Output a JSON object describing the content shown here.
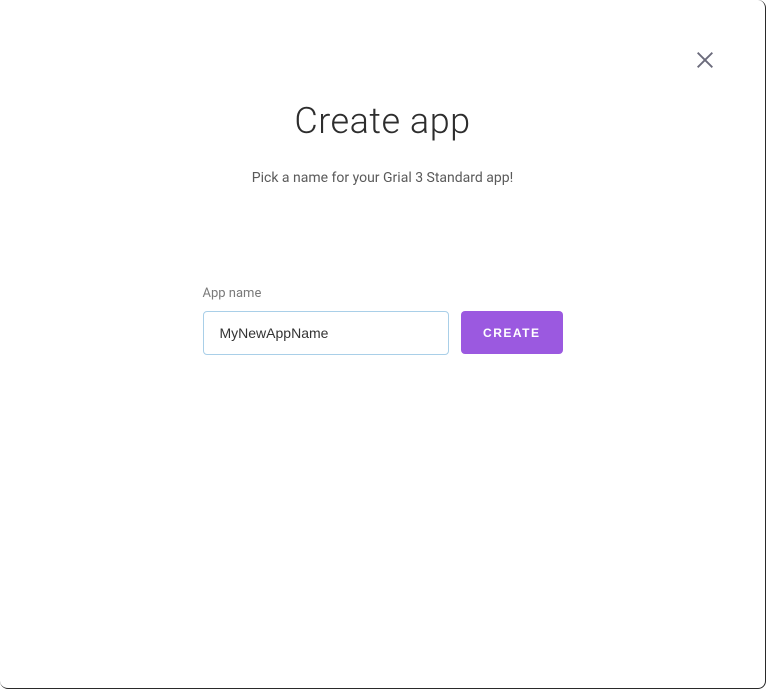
{
  "dialog": {
    "title": "Create app",
    "subtitle": "Pick a name for your Grial 3 Standard app!",
    "form": {
      "app_name_label": "App name",
      "app_name_value": "MyNewAppName",
      "create_button_label": "Create"
    }
  }
}
